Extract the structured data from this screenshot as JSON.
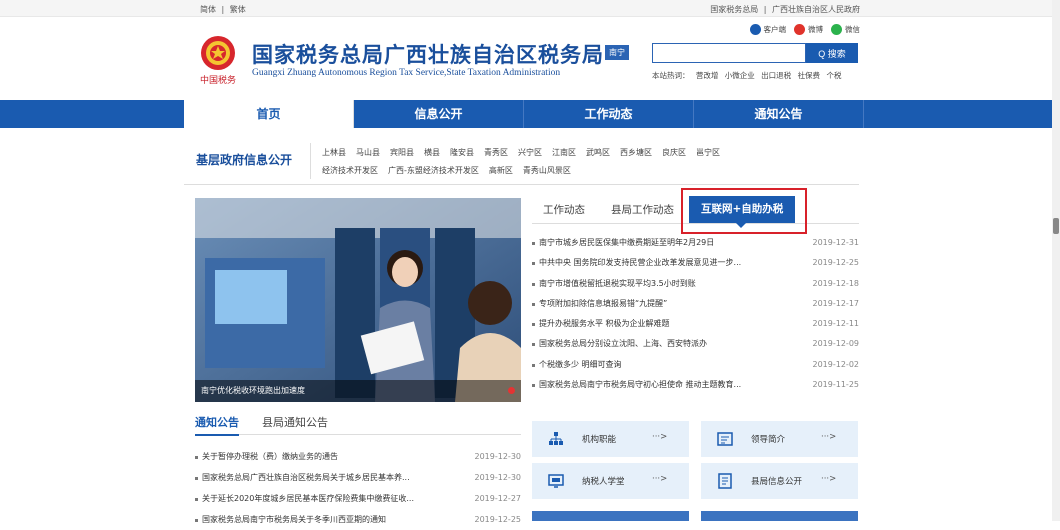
{
  "topbar": {
    "lang_simplified": "简体",
    "lang_sep": "|",
    "lang_traditional": "繁体",
    "link_sat": "国家税务总局",
    "link_sep": "|",
    "link_gov": "广西壮族自治区人民政府"
  },
  "header": {
    "title_cn": "国家税务总局广西壮族自治区税务局",
    "region_badge": "南宁",
    "title_en": "Guangxi Zhuang Autonomous Region Tax Service,State Taxation Administration",
    "social": [
      {
        "label": "客户端",
        "icon": "mobile-client-icon",
        "color": "#1a5bb0"
      },
      {
        "label": "微博",
        "icon": "weibo-icon",
        "color": "#e0332b"
      },
      {
        "label": "微信",
        "icon": "wechat-icon",
        "color": "#2bb24c"
      }
    ],
    "search_placeholder": "",
    "search_button": "Q 搜索",
    "hot_label": "本站热词：",
    "hot_words": [
      "营改增",
      "小微企业",
      "出口退税",
      "社保费",
      "个税"
    ],
    "logo_text": "中国税务"
  },
  "nav": {
    "items": [
      "首页",
      "信息公开",
      "工作动态",
      "通知公告"
    ],
    "active": 0
  },
  "grassroots": {
    "title": "基层政府信息公开",
    "links": [
      "上林县",
      "马山县",
      "宾阳县",
      "横县",
      "隆安县",
      "青秀区",
      "兴宁区",
      "江南区",
      "武鸣区",
      "西乡塘区",
      "良庆区",
      "邕宁区",
      "经济技术开发区",
      "广西-东盟经济技术开发区",
      "高新区",
      "青秀山风景区"
    ]
  },
  "photo": {
    "caption": "南宁优化税收环境跑出加速度"
  },
  "news_tabs": [
    "工作动态",
    "县局工作动态",
    "互联网+自助办税"
  ],
  "news": [
    {
      "title": "南宁市城乡居民医保集中缴费期延至明年2月29日",
      "date": "2019-12-31"
    },
    {
      "title": "中共中央 国务院印发支持民营企业改革发展意见进一步...",
      "date": "2019-12-25"
    },
    {
      "title": "南宁市增值税留抵退税实现平均3.5小时到账",
      "date": "2019-12-18"
    },
    {
      "title": "专项附加扣除信息填报易错“九提醒”",
      "date": "2019-12-17"
    },
    {
      "title": "提升办税服务水平 积极为企业解难题",
      "date": "2019-12-11"
    },
    {
      "title": "国家税务总局分别设立沈阳、上海、西安特派办",
      "date": "2019-12-09"
    },
    {
      "title": "个税缴多少 明细可查询",
      "date": "2019-12-02"
    },
    {
      "title": "国家税务总局南宁市税务局守初心担使命 推动主题教育...",
      "date": "2019-11-25"
    }
  ],
  "notice_tabs": [
    "通知公告",
    "县局通知公告"
  ],
  "notices": [
    {
      "title": "关于暂停办理税（费）缴纳业务的通告",
      "date": "2019-12-30"
    },
    {
      "title": "国家税务总局广西壮族自治区税务局关于城乡居民基本养...",
      "date": "2019-12-30"
    },
    {
      "title": "关于延长2020年度城乡居民基本医疗保险费集中缴费征收...",
      "date": "2019-12-27"
    },
    {
      "title": "国家税务总局南宁市税务局关于冬季川西亚期的通知",
      "date": "2019-12-25"
    }
  ],
  "quick_links": [
    {
      "label": "机构职能",
      "arrow": "···>",
      "icon": "org-chart-icon"
    },
    {
      "label": "领导简介",
      "arrow": "···>",
      "icon": "leader-profile-icon"
    },
    {
      "label": "纳税人学堂",
      "arrow": "···>",
      "icon": "taxpayer-school-icon"
    },
    {
      "label": "县局信息公开",
      "arrow": "···>",
      "icon": "county-info-icon"
    }
  ],
  "colors": {
    "brand": "#1a5bb0",
    "highlight": "#d8212a",
    "quick_bg": "#e6f0fa"
  }
}
